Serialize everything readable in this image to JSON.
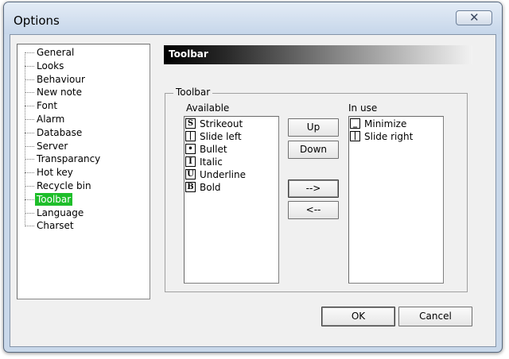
{
  "window": {
    "title": "Options",
    "close_glyph": "✕"
  },
  "tree": {
    "items": [
      "General",
      "Looks",
      "Behaviour",
      "New note",
      "Font",
      "Alarm",
      "Database",
      "Server",
      "Transparancy",
      "Hot key",
      "Recycle bin",
      "Toolbar",
      "Language",
      "Charset"
    ],
    "selected": "Toolbar"
  },
  "panel": {
    "header": "Toolbar",
    "group_label": "Toolbar"
  },
  "available": {
    "label": "Available",
    "items": [
      {
        "icon_glyph": "S",
        "icon": "strikeout-icon",
        "label": "Strikeout"
      },
      {
        "icon_glyph": "|",
        "icon": "slide-left-icon",
        "label": "Slide left"
      },
      {
        "icon_glyph": "•",
        "icon": "bullet-icon",
        "label": "Bullet"
      },
      {
        "icon_glyph": "I",
        "icon": "italic-icon",
        "label": "Italic"
      },
      {
        "icon_glyph": "U",
        "icon": "underline-icon",
        "label": "Underline"
      },
      {
        "icon_glyph": "B",
        "icon": "bold-icon",
        "label": "Bold"
      }
    ]
  },
  "in_use": {
    "label": "In use",
    "items": [
      {
        "icon_glyph": "_",
        "icon": "minimize-icon",
        "label": "Minimize"
      },
      {
        "icon_glyph": "|",
        "icon": "slide-right-icon",
        "label": "Slide right"
      }
    ]
  },
  "buttons": {
    "up": "Up",
    "down": "Down",
    "add": "-->",
    "remove": "<--",
    "ok": "OK",
    "cancel": "Cancel"
  },
  "colors": {
    "selection": "#1ebe2a",
    "frame": "#c9d8ea"
  }
}
